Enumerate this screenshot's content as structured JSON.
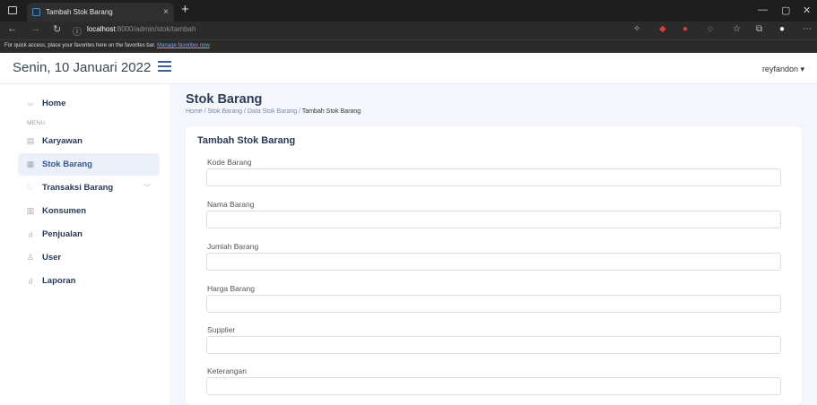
{
  "browser": {
    "tab_title": "Tambah Stok Barang",
    "tab_close": "×",
    "new_tab": "+",
    "url_host": "localhost",
    "url_rest": ":8000/admin/stok/tambah",
    "favbar_text": "For quick access, place your favorites here on the favorites bar.",
    "favbar_link": "Manage favorites now",
    "back": "←",
    "forward": "→",
    "reload": "↻",
    "info": "ⓘ",
    "min": "—",
    "max": "▢",
    "close": "✕"
  },
  "header": {
    "date": "Senin, 10 Januari 2022",
    "user": "reyfandon ▾"
  },
  "sidebar": {
    "home": "Home",
    "menu_label": "MENU",
    "items": [
      {
        "label": "Karyawan",
        "icon": "▤"
      },
      {
        "label": "Stok Barang",
        "icon": "▦"
      },
      {
        "label": "Transaksi Barang",
        "icon": "♡"
      },
      {
        "label": "Konsumen",
        "icon": "▥"
      },
      {
        "label": "Penjualan",
        "icon": "ıl"
      },
      {
        "label": "User",
        "icon": "♙"
      },
      {
        "label": "Laporan",
        "icon": "ıl"
      }
    ],
    "home_icon": "▫▫",
    "chevron": "﹀"
  },
  "page": {
    "title": "Stok Barang",
    "breadcrumb_prefix": "Home / Stok Barang / Data Stok Barang / ",
    "breadcrumb_current": "Tambah Stok Barang"
  },
  "form": {
    "title": "Tambah Stok Barang",
    "fields": [
      {
        "label": "Kode Barang",
        "value": ""
      },
      {
        "label": "Nama Barang",
        "value": ""
      },
      {
        "label": "Jumlah Barang",
        "value": ""
      },
      {
        "label": "Harga Barang",
        "value": ""
      },
      {
        "label": "Supplier",
        "value": ""
      },
      {
        "label": "Keterangan",
        "value": ""
      }
    ]
  }
}
